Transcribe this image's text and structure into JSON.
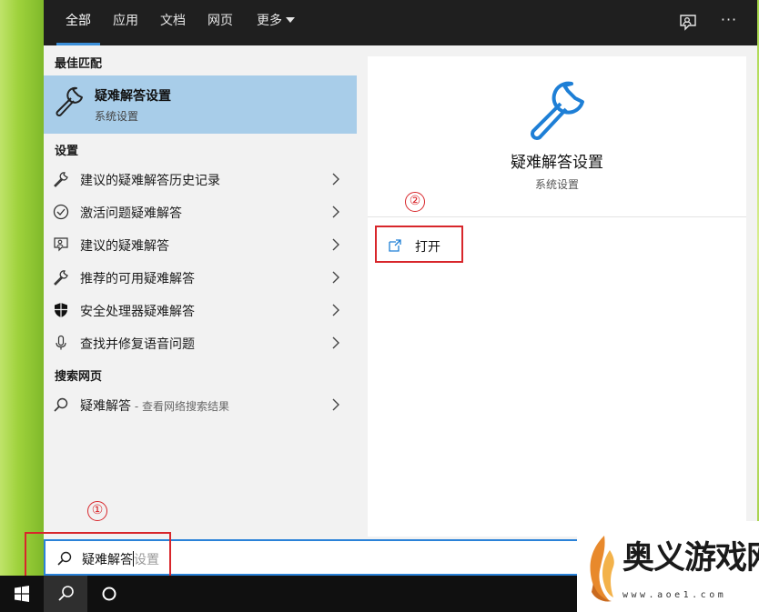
{
  "topbar": {
    "tabs": [
      {
        "label": "全部",
        "active": true
      },
      {
        "label": "应用"
      },
      {
        "label": "文档"
      },
      {
        "label": "网页"
      },
      {
        "label": "更多"
      }
    ],
    "more_options_label": "···",
    "icons": {
      "feedback": "feedback-icon",
      "more": "ellipsis-icon"
    }
  },
  "results": {
    "best_match_header": "最佳匹配",
    "best_match": {
      "title": "疑难解答设置",
      "subtitle": "系统设置",
      "icon": "wrench-icon"
    },
    "settings_header": "设置",
    "settings_items": [
      {
        "label": "建议的疑难解答历史记录",
        "icon": "wrench-icon"
      },
      {
        "label": "激活问题疑难解答",
        "icon": "check-circle-icon"
      },
      {
        "label": "建议的疑难解答",
        "icon": "person-chat-icon"
      },
      {
        "label": "推荐的可用疑难解答",
        "icon": "wrench-icon"
      },
      {
        "label": "安全处理器疑难解答",
        "icon": "shield-icon"
      },
      {
        "label": "查找并修复语音问题",
        "icon": "microphone-icon"
      }
    ],
    "web_header": "搜索网页",
    "web_item": {
      "label": "疑难解答",
      "hint": " - 查看网络搜索结果",
      "icon": "search-icon"
    }
  },
  "preview": {
    "title": "疑难解答设置",
    "subtitle": "系统设置",
    "open_label": "打开",
    "icon": "wrench-icon"
  },
  "annotations": {
    "step1": "①",
    "step2": "②",
    "color": "#d8262b"
  },
  "search": {
    "typed": "疑难解答",
    "ghost": "设置"
  },
  "watermark": {
    "name": "奥义游戏网",
    "url": "www.aoe1.com"
  },
  "colors": {
    "accent": "#2a82d8",
    "selected_bg": "#a8cde9",
    "topbar_bg": "#1f1f1f"
  }
}
